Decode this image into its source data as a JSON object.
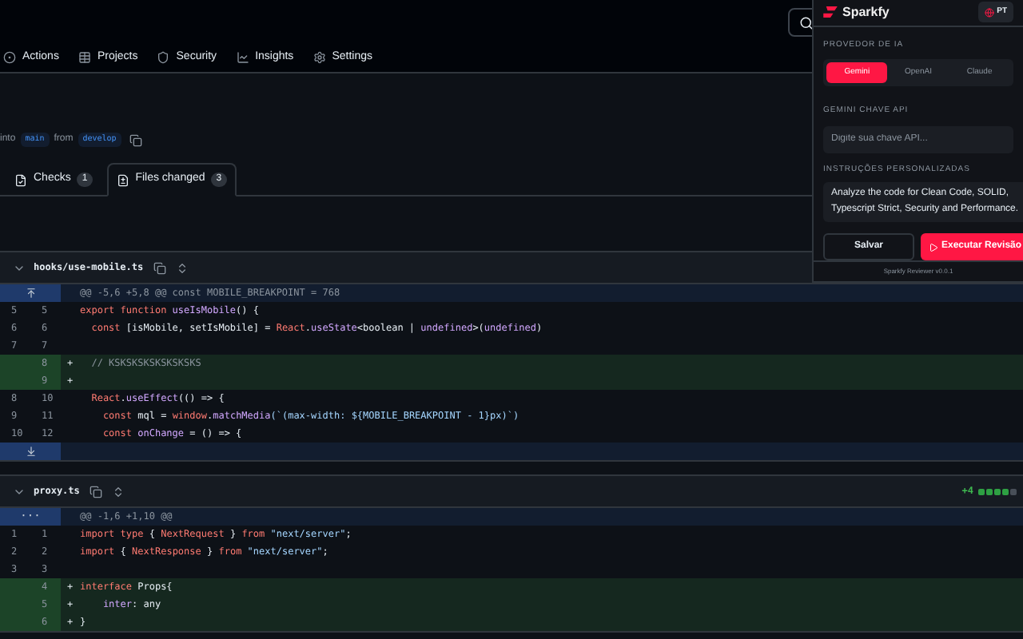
{
  "nav": {
    "items": [
      {
        "label": "Actions"
      },
      {
        "label": "Projects"
      },
      {
        "label": "Security"
      },
      {
        "label": "Insights"
      },
      {
        "label": "Settings"
      }
    ]
  },
  "merge_line": {
    "into": "into",
    "base": "main",
    "from": "from",
    "head": "develop"
  },
  "tabs": [
    {
      "label": "Checks",
      "count": "1",
      "selected": false
    },
    {
      "label": "Files changed",
      "count": "3",
      "selected": true
    }
  ],
  "files": [
    {
      "name": "hooks/use-mobile.ts",
      "rows": [
        {
          "kind": "hunk",
          "text": "@@ -5,6 +5,8 @@ const MOBILE_BREAKPOINT = 768"
        },
        {
          "kind": "context",
          "old": "5",
          "new": "5",
          "tokens": [
            {
              "t": "export function ",
              "kind": "keyword"
            },
            {
              "t": "useIsMobile",
              "kind": "function"
            },
            {
              "t": "() {",
              "kind": "plain"
            }
          ]
        },
        {
          "kind": "context",
          "old": "6",
          "new": "6",
          "tokens": [
            {
              "t": "  const ",
              "kind": "keyword"
            },
            {
              "t": "[isMobile, setIsMobile] = ",
              "kind": "plain"
            },
            {
              "t": "React",
              "kind": "keyword"
            },
            {
              "t": ".",
              "kind": "plain"
            },
            {
              "t": "useState",
              "kind": "function"
            },
            {
              "t": "<boolean | ",
              "kind": "plain"
            },
            {
              "t": "undefined",
              "kind": "function"
            },
            {
              "t": ">(",
              "kind": "plain"
            },
            {
              "t": "undefined",
              "kind": "function"
            },
            {
              "t": ")",
              "kind": "plain"
            }
          ]
        },
        {
          "kind": "context",
          "old": "7",
          "new": "7",
          "tokens": []
        },
        {
          "kind": "add",
          "new": "8",
          "marker": "+",
          "tokens": [
            {
              "t": "  // KSKSKSKSKSKSKSKS",
              "kind": "comment"
            }
          ]
        },
        {
          "kind": "add",
          "new": "9",
          "marker": "+",
          "tokens": []
        },
        {
          "kind": "context",
          "old": "8",
          "new": "10",
          "tokens": [
            {
              "t": "  React",
              "kind": "keyword"
            },
            {
              "t": ".",
              "kind": "plain"
            },
            {
              "t": "useEffect",
              "kind": "function"
            },
            {
              "t": "(() => {",
              "kind": "plain"
            }
          ]
        },
        {
          "kind": "context",
          "old": "9",
          "new": "11",
          "tokens": [
            {
              "t": "    const ",
              "kind": "keyword"
            },
            {
              "t": "mql = ",
              "kind": "plain"
            },
            {
              "t": "window",
              "kind": "keyword"
            },
            {
              "t": ".",
              "kind": "plain"
            },
            {
              "t": "matchMedia",
              "kind": "function"
            },
            {
              "t": "(`(max-width: ${MOBILE_BREAKPOINT - 1}px)`)",
              "kind": "string"
            }
          ]
        },
        {
          "kind": "context",
          "old": "10",
          "new": "12",
          "tokens": [
            {
              "t": "    const ",
              "kind": "keyword"
            },
            {
              "t": "onChange",
              "kind": "function"
            },
            {
              "t": " = () => {",
              "kind": "plain"
            }
          ]
        },
        {
          "kind": "expand"
        }
      ]
    },
    {
      "name": "proxy.ts",
      "stat": {
        "added": "+4",
        "blocks": [
          {
            "kind": "add"
          },
          {
            "kind": "add"
          },
          {
            "kind": "add"
          },
          {
            "kind": "add"
          },
          {
            "kind": "neutral"
          }
        ]
      },
      "rows": [
        {
          "kind": "hunk",
          "text": "@@ -1,6 +1,10 @@",
          "expander": "···"
        },
        {
          "kind": "context",
          "old": "1",
          "new": "1",
          "tokens": [
            {
              "t": "import type ",
              "kind": "keyword"
            },
            {
              "t": "{ ",
              "kind": "plain"
            },
            {
              "t": "NextRequest",
              "kind": "keyword"
            },
            {
              "t": " } ",
              "kind": "plain"
            },
            {
              "t": "from ",
              "kind": "keyword"
            },
            {
              "t": "\"next/server\"",
              "kind": "string"
            },
            {
              "t": ";",
              "kind": "plain"
            }
          ]
        },
        {
          "kind": "context",
          "old": "2",
          "new": "2",
          "tokens": [
            {
              "t": "import ",
              "kind": "keyword"
            },
            {
              "t": "{ ",
              "kind": "plain"
            },
            {
              "t": "NextResponse",
              "kind": "keyword"
            },
            {
              "t": " } ",
              "kind": "plain"
            },
            {
              "t": "from ",
              "kind": "keyword"
            },
            {
              "t": "\"next/server\"",
              "kind": "string"
            },
            {
              "t": ";",
              "kind": "plain"
            }
          ]
        },
        {
          "kind": "context",
          "old": "3",
          "new": "3",
          "tokens": []
        },
        {
          "kind": "add",
          "new": "4",
          "marker": "+",
          "tokens": [
            {
              "t": "interface ",
              "kind": "keyword"
            },
            {
              "t": "Props{",
              "kind": "plain"
            }
          ]
        },
        {
          "kind": "add",
          "new": "5",
          "marker": "+",
          "tokens": [
            {
              "t": "    inter",
              "kind": "function"
            },
            {
              "t": ": any",
              "kind": "plain"
            }
          ]
        },
        {
          "kind": "add",
          "new": "6",
          "marker": "+",
          "tokens": [
            {
              "t": "}",
              "kind": "plain"
            }
          ]
        }
      ]
    }
  ],
  "extension": {
    "brand": "Sparkfy",
    "language": "PT",
    "provider_label": "PROVEDOR DE IA",
    "providers": [
      {
        "label": "Gemini",
        "selected": true
      },
      {
        "label": "OpenAI",
        "selected": false
      },
      {
        "label": "Claude",
        "selected": false
      }
    ],
    "key_label": "GEMINI CHAVE API",
    "key_placeholder": "Digite sua chave API...",
    "instructions_label": "INSTRUÇÕES PERSONALIZADAS",
    "instructions": "Analyze the code for Clean Code, SOLID, Typescript Strict, Security and Performance.",
    "save": "Salvar",
    "run": "Executar Revisão",
    "footer": "Sparkfy Reviewer v0.0.1"
  }
}
